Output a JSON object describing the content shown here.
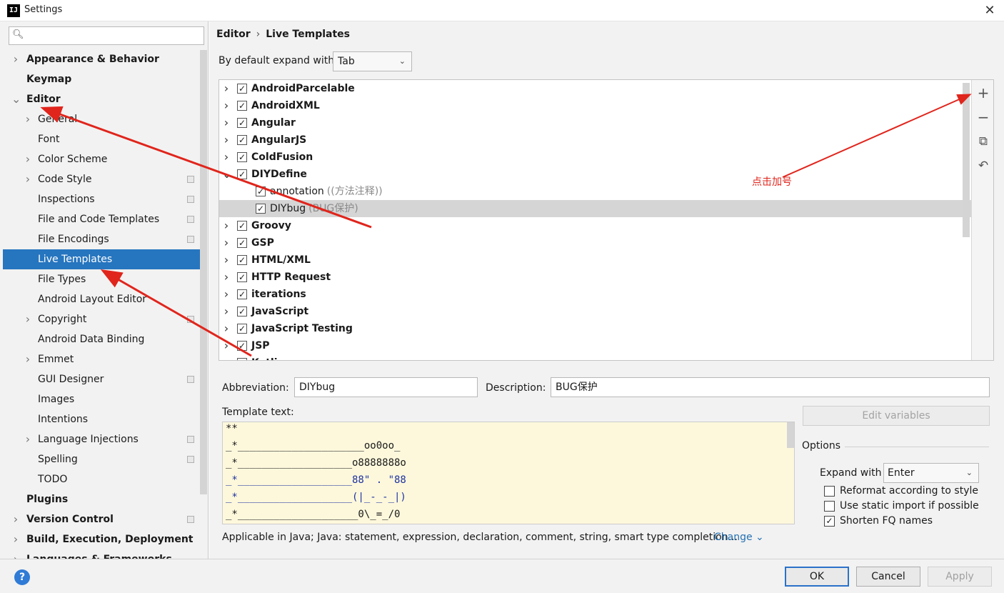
{
  "window": {
    "app_icon": "IJ",
    "title": "Settings",
    "close": "✕"
  },
  "search": {
    "placeholder": "",
    "icon": "search-icon"
  },
  "tree": [
    {
      "label": "Appearance & Behavior",
      "level": 0,
      "expand": "collapsed"
    },
    {
      "label": "Keymap",
      "level": 0,
      "expand": "none"
    },
    {
      "label": "Editor",
      "level": 0,
      "expand": "expanded"
    },
    {
      "label": "General",
      "level": 1,
      "expand": "collapsed"
    },
    {
      "label": "Font",
      "level": 1,
      "expand": "none"
    },
    {
      "label": "Color Scheme",
      "level": 1,
      "expand": "collapsed"
    },
    {
      "label": "Code Style",
      "level": 1,
      "expand": "collapsed",
      "project": true
    },
    {
      "label": "Inspections",
      "level": 1,
      "expand": "none",
      "project": true
    },
    {
      "label": "File and Code Templates",
      "level": 1,
      "expand": "none",
      "project": true
    },
    {
      "label": "File Encodings",
      "level": 1,
      "expand": "none",
      "project": true
    },
    {
      "label": "Live Templates",
      "level": 1,
      "expand": "none",
      "selected": true
    },
    {
      "label": "File Types",
      "level": 1,
      "expand": "none"
    },
    {
      "label": "Android Layout Editor",
      "level": 1,
      "expand": "none"
    },
    {
      "label": "Copyright",
      "level": 1,
      "expand": "collapsed",
      "project": true
    },
    {
      "label": "Android Data Binding",
      "level": 1,
      "expand": "none"
    },
    {
      "label": "Emmet",
      "level": 1,
      "expand": "collapsed"
    },
    {
      "label": "GUI Designer",
      "level": 1,
      "expand": "none",
      "project": true
    },
    {
      "label": "Images",
      "level": 1,
      "expand": "none"
    },
    {
      "label": "Intentions",
      "level": 1,
      "expand": "none"
    },
    {
      "label": "Language Injections",
      "level": 1,
      "expand": "collapsed",
      "project": true
    },
    {
      "label": "Spelling",
      "level": 1,
      "expand": "none",
      "project": true
    },
    {
      "label": "TODO",
      "level": 1,
      "expand": "none"
    },
    {
      "label": "Plugins",
      "level": 0,
      "expand": "none"
    },
    {
      "label": "Version Control",
      "level": 0,
      "expand": "collapsed",
      "project": true
    },
    {
      "label": "Build, Execution, Deployment",
      "level": 0,
      "expand": "collapsed"
    },
    {
      "label": "Languages & Frameworks",
      "level": 0,
      "expand": "collapsed"
    }
  ],
  "breadcrumb": {
    "parent": "Editor",
    "separator": "›",
    "current": "Live Templates"
  },
  "expand_with": {
    "label": "By default expand with",
    "value": "Tab"
  },
  "templates": [
    {
      "type": "group",
      "label": "AndroidParcelable",
      "checked": true,
      "expand": "collapsed"
    },
    {
      "type": "group",
      "label": "AndroidXML",
      "checked": true,
      "expand": "collapsed"
    },
    {
      "type": "group",
      "label": "Angular",
      "checked": true,
      "expand": "collapsed"
    },
    {
      "type": "group",
      "label": "AngularJS",
      "checked": true,
      "expand": "collapsed"
    },
    {
      "type": "group",
      "label": "ColdFusion",
      "checked": true,
      "expand": "collapsed"
    },
    {
      "type": "group",
      "label": "DIYDefine",
      "checked": true,
      "expand": "expanded"
    },
    {
      "type": "child",
      "label": "annotation",
      "desc": "((方法注释))",
      "checked": true
    },
    {
      "type": "child",
      "label": "DIYbug",
      "desc": "(BUG保护)",
      "checked": true,
      "selected": true
    },
    {
      "type": "group",
      "label": "Groovy",
      "checked": true,
      "expand": "collapsed"
    },
    {
      "type": "group",
      "label": "GSP",
      "checked": true,
      "expand": "collapsed"
    },
    {
      "type": "group",
      "label": "HTML/XML",
      "checked": true,
      "expand": "collapsed"
    },
    {
      "type": "group",
      "label": "HTTP Request",
      "checked": true,
      "expand": "collapsed"
    },
    {
      "type": "group",
      "label": "iterations",
      "checked": true,
      "expand": "collapsed"
    },
    {
      "type": "group",
      "label": "JavaScript",
      "checked": true,
      "expand": "collapsed"
    },
    {
      "type": "group",
      "label": "JavaScript Testing",
      "checked": true,
      "expand": "collapsed"
    },
    {
      "type": "group",
      "label": "JSP",
      "checked": true,
      "expand": "collapsed"
    },
    {
      "type": "group",
      "label": "Kotlin",
      "checked": true,
      "expand": "collapsed"
    }
  ],
  "list_tools": [
    {
      "name": "add-icon",
      "glyph": "+"
    },
    {
      "name": "remove-icon",
      "glyph": "−"
    },
    {
      "name": "copy-icon",
      "glyph": "⧉"
    },
    {
      "name": "restore-icon",
      "glyph": "↶"
    }
  ],
  "annotation_text": "点击加号",
  "form": {
    "abbreviation_label": "Abbreviation:",
    "abbreviation_value": "DIYbug",
    "description_label": "Description:",
    "description_value": "BUG保护",
    "template_text_label": "Template text:",
    "edit_variables": "Edit variables",
    "template_lines": [
      {
        "text": "**",
        "hl": false
      },
      {
        "text": "_*_____________________oo0oo_",
        "hl": false
      },
      {
        "text": "_*___________________o8888888o",
        "hl": false
      },
      {
        "text": "_*___________________88\" . \"88",
        "hl": true
      },
      {
        "text": "_*___________________(|_-_-_|)",
        "hl": true
      },
      {
        "text": "_*____________________0\\_=_/0",
        "hl": false
      }
    ]
  },
  "options": {
    "title": "Options",
    "expand_with_label": "Expand with",
    "expand_with_value": "Enter",
    "checks": [
      {
        "label": "Reformat according to style",
        "checked": false
      },
      {
        "label": "Use static import if possible",
        "checked": false
      },
      {
        "label": "Shorten FQ names",
        "checked": true
      }
    ]
  },
  "applicable": {
    "text": "Applicable in Java; Java: statement, expression, declaration, comment, string, smart type completion...",
    "change_label": "Change ⌄"
  },
  "buttons": {
    "help": "?",
    "ok": "OK",
    "cancel": "Cancel",
    "apply": "Apply"
  },
  "colors": {
    "selection": "#2675bf",
    "annotation": "#e0251c",
    "link": "#2470b3",
    "template_bg": "#fdf8dc"
  }
}
